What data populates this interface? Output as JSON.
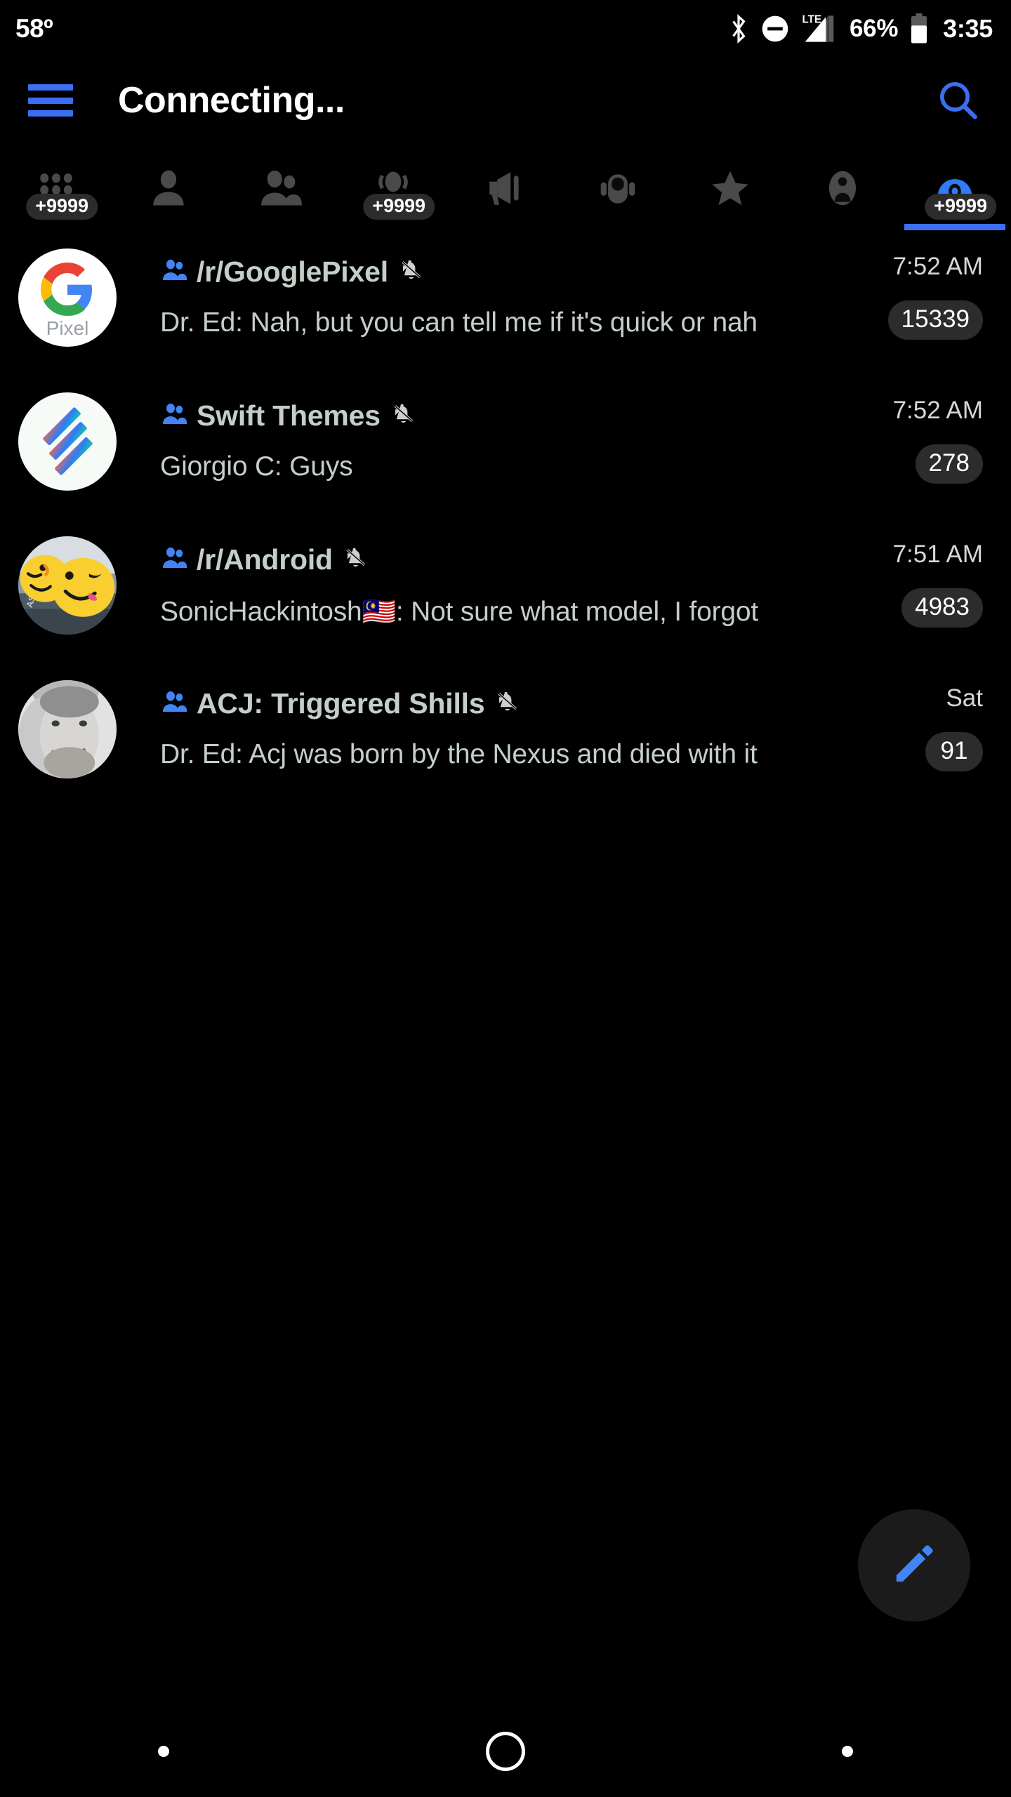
{
  "status_bar": {
    "temperature": "58º",
    "battery_percent": "66%",
    "clock": "3:35",
    "network_label": "LTE",
    "icons": [
      "bluetooth-icon",
      "do-not-disturb-icon",
      "signal-icon",
      "battery-icon"
    ]
  },
  "app_bar": {
    "menu_icon": "hamburger-menu-icon",
    "title": "Connecting...",
    "search_icon": "search-icon"
  },
  "tabs": [
    {
      "id": "all",
      "icon": "dots-grid-icon",
      "badge": "+9999",
      "active": false
    },
    {
      "id": "private",
      "icon": "person-icon",
      "badge": "",
      "active": false
    },
    {
      "id": "groups",
      "icon": "people-icon",
      "badge": "",
      "active": false
    },
    {
      "id": "supergroups",
      "icon": "group-circle-icon",
      "badge": "+9999",
      "active": false
    },
    {
      "id": "channels",
      "icon": "megaphone-icon",
      "badge": "",
      "active": false
    },
    {
      "id": "bots",
      "icon": "robot-icon",
      "badge": "",
      "active": false
    },
    {
      "id": "favorites",
      "icon": "star-icon",
      "badge": "",
      "active": false
    },
    {
      "id": "contacts",
      "icon": "contact-badge-icon",
      "badge": "",
      "active": false
    },
    {
      "id": "unread",
      "icon": "unread-arc-icon",
      "badge": "+9999",
      "active": true
    }
  ],
  "chats": [
    {
      "avatar": "google-pixel-logo",
      "avatar_text": "Pixel",
      "title": "/r/GooglePixel",
      "muted": true,
      "is_group": true,
      "snippet": "Dr. Ed: Nah, but you can tell me if it's quick or nah",
      "time": "7:52 AM",
      "unread": "15339"
    },
    {
      "avatar": "swift-themes-logo",
      "avatar_text": "",
      "title": "Swift Themes",
      "muted": true,
      "is_group": true,
      "snippet": "Giorgio C: Guys",
      "time": "7:52 AM",
      "unread": "278"
    },
    {
      "avatar": "emoji-blob-photo",
      "avatar_text": "",
      "title": "/r/Android",
      "muted": true,
      "is_group": true,
      "snippet": "SonicHackintosh🇲🇾: Not sure what model, I forgot",
      "time": "7:51 AM",
      "unread": "4983"
    },
    {
      "avatar": "man-portrait-photo",
      "avatar_text": "",
      "title": "ACJ: Triggered Shills",
      "muted": true,
      "is_group": true,
      "snippet": "Dr. Ed: Acj was born by the Nexus and died with it",
      "time": "Sat",
      "unread": "91"
    }
  ],
  "fab": {
    "icon": "pencil-compose-icon",
    "label": "Compose"
  },
  "nav_bar": {
    "back": "back-dot",
    "home": "home-circle",
    "recents": "recents-dot"
  },
  "colors": {
    "accent_blue": "#3b6ef0",
    "background": "#000000",
    "title_text": "#c3cfc7",
    "badge_bg": "#2c2c2c",
    "tab_inactive": "#4a4a4a"
  }
}
